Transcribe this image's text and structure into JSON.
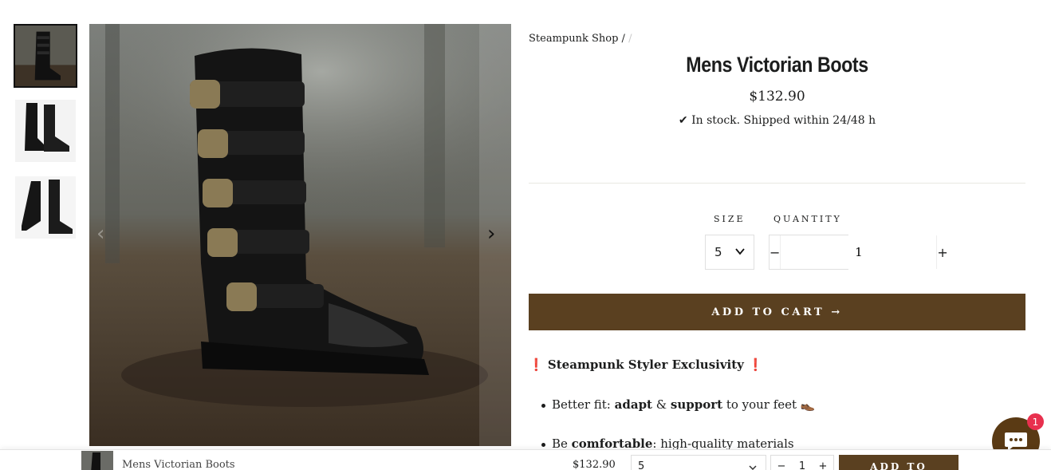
{
  "breadcrumb": {
    "shop": "Steampunk Shop",
    "separator": "/"
  },
  "product": {
    "title": "Mens Victorian Boots",
    "price": "$132.90",
    "stock_check": "✔",
    "stock": "In stock. Shipped within 24/48 h"
  },
  "options": {
    "size_label": "SIZE",
    "size_value": "5",
    "quantity_label": "QUANTITY",
    "quantity_value": "1",
    "minus": "−",
    "plus": "+"
  },
  "add_to_cart": "ADD TO CART →",
  "description": {
    "exclusivity": "Steampunk Styler Exclusivity",
    "bang": "❗",
    "bullets": [
      {
        "pre": "Better fit: ",
        "b1": "adapt",
        "mid": " & ",
        "b2": "support",
        "post": " to your feet 👞"
      },
      {
        "pre": "Be ",
        "b1": "comfortable",
        "post": ": high-quality materials"
      }
    ]
  },
  "carousel": {
    "prev": "‹",
    "next": "›"
  },
  "chat": {
    "badge": "1"
  },
  "sticky": {
    "title": "Mens Victorian Boots",
    "price": "$132.90",
    "size": "5",
    "minus": "−",
    "qty": "1",
    "plus": "+",
    "add": "ADD TO"
  },
  "colors": {
    "button": "#5a4020",
    "chat": "#5a3a14",
    "badge": "#e8304e"
  }
}
